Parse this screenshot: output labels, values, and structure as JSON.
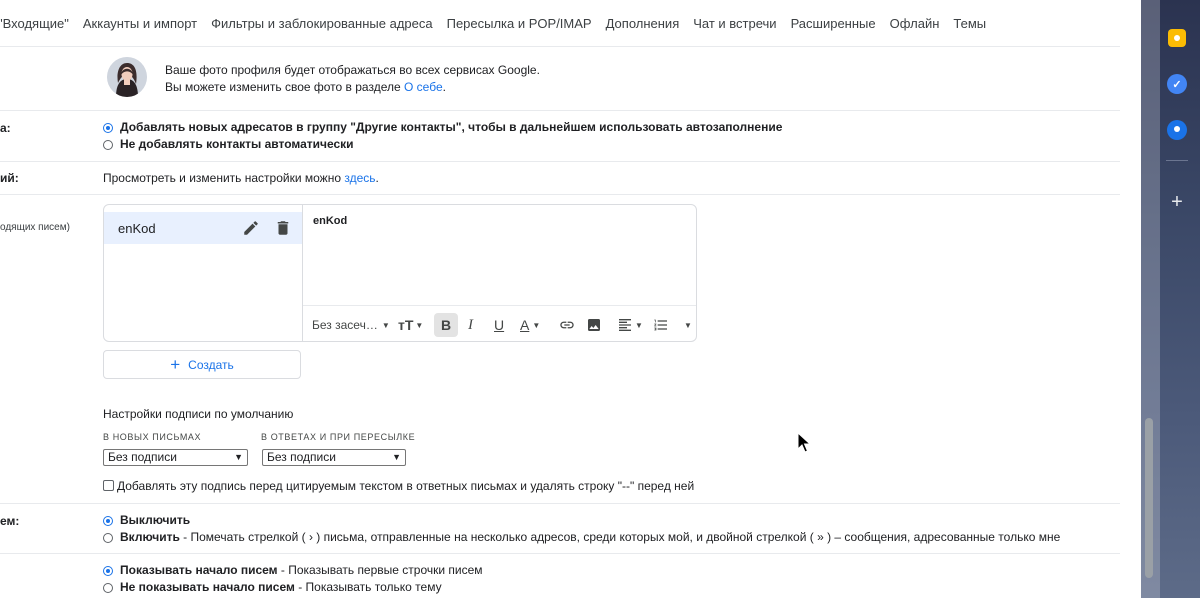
{
  "tabs": [
    "\"Входящие\"",
    "Аккаунты и импорт",
    "Фильтры и заблокированные адреса",
    "Пересылка и POP/IMAP",
    "Дополнения",
    "Чат и встречи",
    "Расширенные",
    "Офлайн",
    "Темы"
  ],
  "profile": {
    "line1": "Ваше фото профиля будет отображаться во всех сервисах Google.",
    "line2_prefix": "Вы можете изменить свое фото в разделе ",
    "line2_link": "О себе",
    "line2_suffix": "."
  },
  "contacts": {
    "label": "а:",
    "option1": "Добавлять новых адресатов в группу \"Другие контакты\", чтобы в дальнейшем использовать автозаполнение",
    "option2": "Не добавлять контакты автоматически"
  },
  "settings_row": {
    "label": "ий:",
    "text": "Просмотреть и изменить настройки можно ",
    "link": "здесь",
    "suffix": "."
  },
  "signature": {
    "label": "одящих писем)",
    "item_name": "enKod",
    "editor_text": "enKod",
    "font_select": "Без засеч…",
    "create_label": "Создать"
  },
  "signature_defaults": {
    "heading": "Настройки подписи по умолчанию",
    "new_caption": "В НОВЫХ ПИСЬМАХ",
    "reply_caption": "В ОТВЕТАХ И ПРИ ПЕРЕСЫЛКЕ",
    "new_value": "Без подписи",
    "reply_value": "Без подписи",
    "checkbox_text": "Добавлять эту подпись перед цитируемым текстом в ответных письмах и удалять строку \"--\" перед ней"
  },
  "indicators": {
    "label": "ем:",
    "option1": "Выключить",
    "option2_bold": "Включить",
    "option2_rest": " - Помечать стрелкой ( › ) письма, отправленные на несколько адресов, среди которых мой, и двойной стрелкой ( » ) – сообщения, адресованные только мне"
  },
  "snippets": {
    "option1_bold": "Показывать начало писем",
    "option1_rest": " - Показывать первые строчки писем",
    "option2_bold": "Не показывать начало писем",
    "option2_rest": " - Показывать только тему"
  },
  "colors": {
    "accent": "#1a73e8",
    "selected_bg": "#e8f0fe",
    "keep": "#fbbc04"
  }
}
